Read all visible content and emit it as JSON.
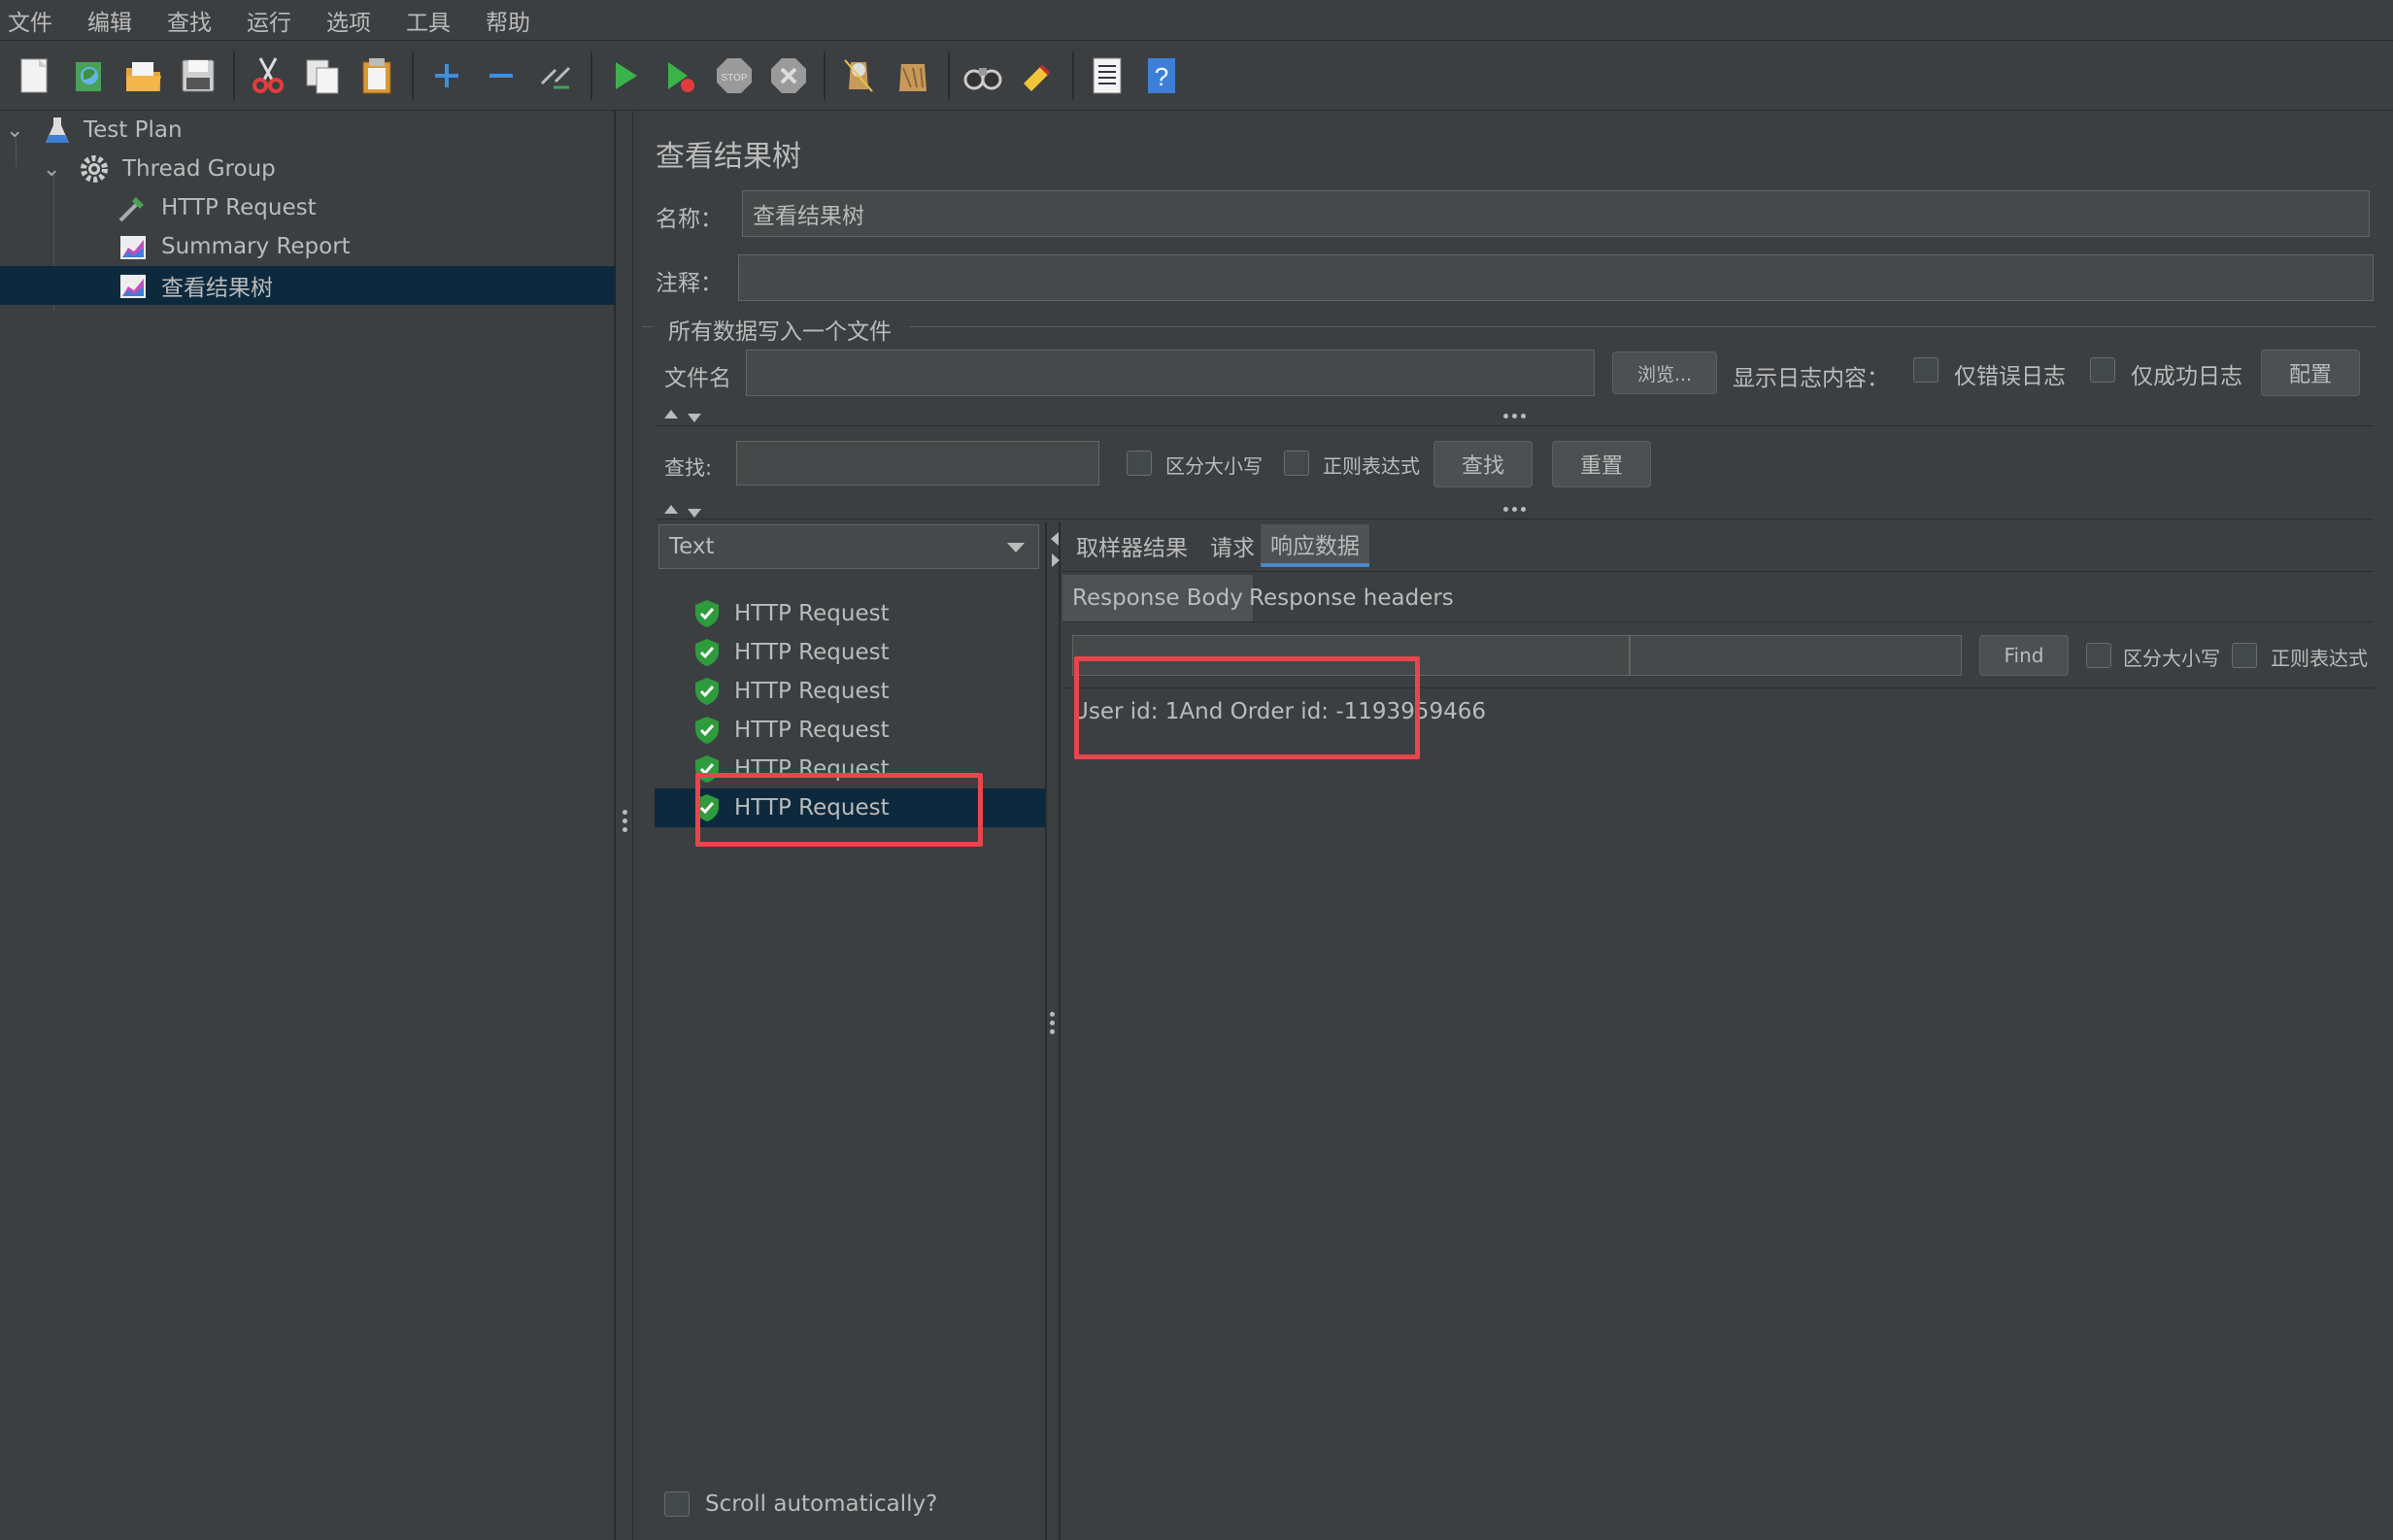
{
  "menu": [
    "文件",
    "编辑",
    "查找",
    "运行",
    "选项",
    "工具",
    "帮助"
  ],
  "toolbar": [
    "new-icon",
    "templates-icon",
    "open-icon",
    "save-icon",
    "cut-icon",
    "copy-icon",
    "paste-icon",
    "expand-icon",
    "collapse-icon",
    "toggle-icon",
    "start-icon",
    "start-no-pause-icon",
    "stop-icon",
    "shutdown-icon",
    "clear-icon",
    "clear-all-icon",
    "search-icon",
    "reset-search-icon",
    "function-helper-icon",
    "help-icon"
  ],
  "tree": {
    "items": [
      {
        "label": "Test Plan",
        "icon": "flask-icon"
      },
      {
        "label": "Thread Group",
        "icon": "gear-icon"
      },
      {
        "label": "HTTP Request",
        "icon": "pipette-icon"
      },
      {
        "label": "Summary Report",
        "icon": "chart-icon"
      },
      {
        "label": "查看结果树",
        "icon": "chart-icon",
        "selected": true
      }
    ]
  },
  "main": {
    "title": "查看结果树",
    "name_label": "名称：",
    "name_value": "查看结果树",
    "comment_label": "注释：",
    "comment_value": "",
    "group_title": "所有数据写入一个文件",
    "filename_label": "文件名",
    "filename_value": "",
    "browse_label": "浏览...",
    "log_display_label": "显示日志内容：",
    "errors_only_label": "仅错误日志",
    "success_only_label": "仅成功日志",
    "configure_label": "配置",
    "search_label": "查找:",
    "search_value": "",
    "case_sensitive_label": "区分大小写",
    "regex_label": "正则表达式",
    "search_button": "查找",
    "reset_button": "重置",
    "renderer_select": "Text",
    "results": [
      "HTTP Request",
      "HTTP Request",
      "HTTP Request",
      "HTTP Request",
      "HTTP Request",
      "HTTP Request"
    ],
    "selected_result_index": 5,
    "scroll_auto_label": "Scroll automatically?",
    "tabs": [
      "取样器结果",
      "请求",
      "响应数据"
    ],
    "active_tab": "响应数据",
    "subtabs": [
      "Response Body",
      "Response headers"
    ],
    "active_subtab": "Response Body",
    "find_value": "",
    "find_button": "Find",
    "find_case_label": "区分大小写",
    "find_regex_label": "正则表达式",
    "response_body": "User id: 1And Order id: -1193959466"
  },
  "colors": {
    "background": "#3c3f41",
    "selection": "#0d293e",
    "highlight_box": "#e8454d",
    "success_green": "#2e9c3c",
    "active_tab_underline": "#4a88c7"
  }
}
